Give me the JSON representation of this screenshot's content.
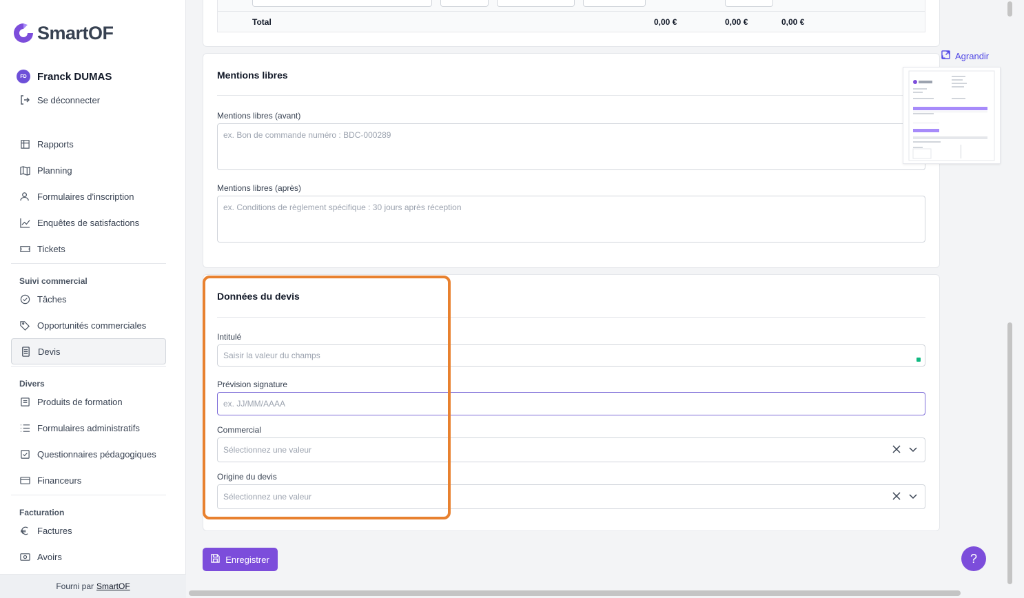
{
  "brand": {
    "name": "SmartOF",
    "accent": "#7c4ddb",
    "highlight": "#e8812f"
  },
  "user": {
    "initials": "FD",
    "name": "Franck DUMAS",
    "logout": "Se déconnecter"
  },
  "nav": {
    "main": [
      {
        "label": "Rapports",
        "icon": "table-icon"
      },
      {
        "label": "Planning",
        "icon": "map-icon"
      },
      {
        "label": "Formulaires d'inscription",
        "icon": "user-icon"
      },
      {
        "label": "Enquêtes de satisfactions",
        "icon": "chart-icon"
      },
      {
        "label": "Tickets",
        "icon": "ticket-icon"
      }
    ],
    "suivi_title": "Suivi commercial",
    "suivi": [
      {
        "label": "Tâches",
        "icon": "check-circle-icon"
      },
      {
        "label": "Opportunités commerciales",
        "icon": "tag-icon"
      },
      {
        "label": "Devis",
        "icon": "document-icon",
        "active": true
      }
    ],
    "divers_title": "Divers",
    "divers": [
      {
        "label": "Produits de formation",
        "icon": "book-icon"
      },
      {
        "label": "Formulaires administratifs",
        "icon": "list-icon"
      },
      {
        "label": "Questionnaires pédagogiques",
        "icon": "checkbox-icon"
      },
      {
        "label": "Financeurs",
        "icon": "card-icon"
      }
    ],
    "facturation_title": "Facturation",
    "facturation": [
      {
        "label": "Factures",
        "icon": "euro-icon"
      },
      {
        "label": "Avoirs",
        "icon": "cash-icon"
      }
    ]
  },
  "footer": {
    "prefix": "Fourni par",
    "link": "SmartOF"
  },
  "totals": {
    "label": "Total",
    "col1": "0,00 €",
    "col2": "0,00 €",
    "col3": "0,00 €"
  },
  "mentions": {
    "title": "Mentions libres",
    "before_label": "Mentions libres (avant)",
    "before_placeholder": "ex. Bon de commande numéro : BDC-000289",
    "after_label": "Mentions libres (après)",
    "after_placeholder": "ex. Conditions de règlement spécifique : 30 jours après réception"
  },
  "devis": {
    "title": "Données du devis",
    "intitule_label": "Intitulé",
    "intitule_placeholder": "Saisir la valeur du champs",
    "prevision_label": "Prévision signature",
    "prevision_placeholder": "ex. JJ/MM/AAAA",
    "commercial_label": "Commercial",
    "commercial_placeholder": "Sélectionnez une valeur",
    "origine_label": "Origine du devis",
    "origine_placeholder": "Sélectionnez une valeur"
  },
  "actions": {
    "save": "Enregistrer",
    "enlarge": "Agrandir",
    "help": "?"
  }
}
